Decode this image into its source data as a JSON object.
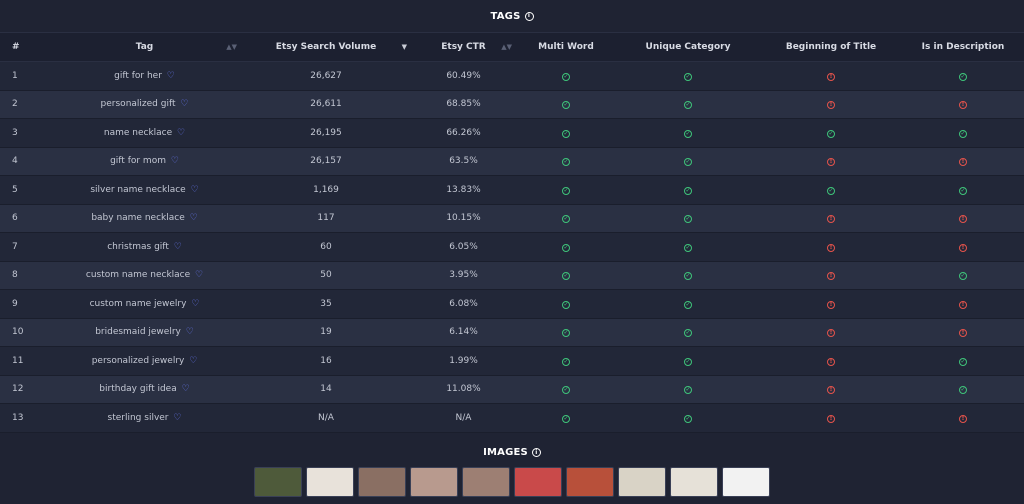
{
  "tags_section": {
    "title": "TAGS"
  },
  "table": {
    "headers": [
      "#",
      "Tag",
      "Etsy Search Volume",
      "Etsy CTR",
      "Multi Word",
      "Unique Category",
      "Beginning of Title",
      "Is in Description"
    ],
    "rows": [
      {
        "num": "1",
        "tag": "gift for her",
        "volume": "26,627",
        "ctr": "60.49%",
        "multi": true,
        "unique": true,
        "begin": false,
        "desc": true
      },
      {
        "num": "2",
        "tag": "personalized gift",
        "volume": "26,611",
        "ctr": "68.85%",
        "multi": true,
        "unique": true,
        "begin": false,
        "desc": false
      },
      {
        "num": "3",
        "tag": "name necklace",
        "volume": "26,195",
        "ctr": "66.26%",
        "multi": true,
        "unique": true,
        "begin": true,
        "desc": true
      },
      {
        "num": "4",
        "tag": "gift for mom",
        "volume": "26,157",
        "ctr": "63.5%",
        "multi": true,
        "unique": true,
        "begin": false,
        "desc": false
      },
      {
        "num": "5",
        "tag": "silver name necklace",
        "volume": "1,169",
        "ctr": "13.83%",
        "multi": true,
        "unique": true,
        "begin": true,
        "desc": true
      },
      {
        "num": "6",
        "tag": "baby name necklace",
        "volume": "117",
        "ctr": "10.15%",
        "multi": true,
        "unique": true,
        "begin": false,
        "desc": false
      },
      {
        "num": "7",
        "tag": "christmas gift",
        "volume": "60",
        "ctr": "6.05%",
        "multi": true,
        "unique": true,
        "begin": false,
        "desc": false
      },
      {
        "num": "8",
        "tag": "custom name necklace",
        "volume": "50",
        "ctr": "3.95%",
        "multi": true,
        "unique": true,
        "begin": false,
        "desc": true
      },
      {
        "num": "9",
        "tag": "custom name jewelry",
        "volume": "35",
        "ctr": "6.08%",
        "multi": true,
        "unique": true,
        "begin": false,
        "desc": false
      },
      {
        "num": "10",
        "tag": "bridesmaid jewelry",
        "volume": "19",
        "ctr": "6.14%",
        "multi": true,
        "unique": true,
        "begin": false,
        "desc": false
      },
      {
        "num": "11",
        "tag": "personalized jewelry",
        "volume": "16",
        "ctr": "1.99%",
        "multi": true,
        "unique": true,
        "begin": false,
        "desc": true
      },
      {
        "num": "12",
        "tag": "birthday gift idea",
        "volume": "14",
        "ctr": "11.08%",
        "multi": true,
        "unique": true,
        "begin": false,
        "desc": true
      },
      {
        "num": "13",
        "tag": "sterling silver",
        "volume": "N/A",
        "ctr": "N/A",
        "multi": true,
        "unique": true,
        "begin": false,
        "desc": false
      }
    ]
  },
  "images_section": {
    "title": "IMAGES"
  },
  "thumbnails": [
    {
      "color": "#4e5a3a"
    },
    {
      "color": "#e8e2da"
    },
    {
      "color": "#8a6f63"
    },
    {
      "color": "#b89a8e"
    },
    {
      "color": "#9d7f73"
    },
    {
      "color": "#c94a4a"
    },
    {
      "color": "#b8503a"
    },
    {
      "color": "#d9d3c6"
    },
    {
      "color": "#e6e1d8"
    },
    {
      "color": "#f2f2f2"
    }
  ],
  "colors": {
    "ok": "#3ec47a",
    "bad": "#e5534b",
    "heart": "#6b7cff"
  }
}
